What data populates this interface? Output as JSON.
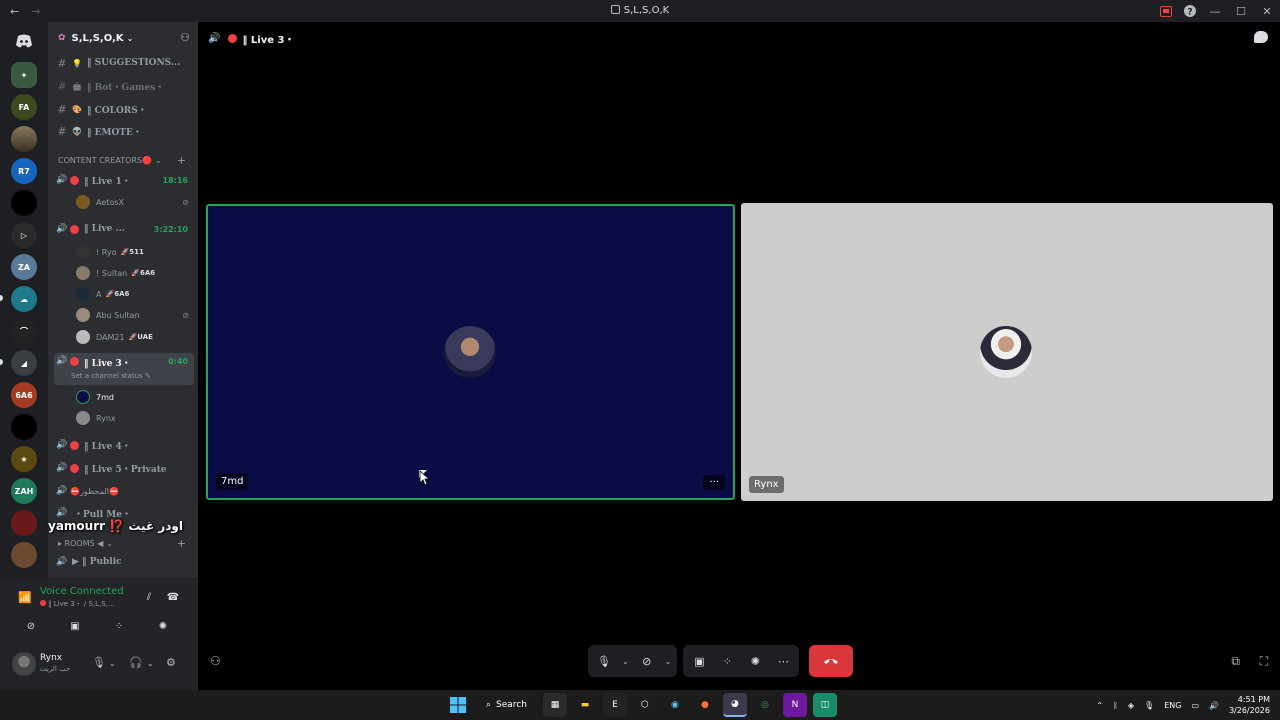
{
  "window": {
    "title": "S,L,S,O,K",
    "back_glyph": "←",
    "forward_glyph": "→"
  },
  "server": {
    "name": "S,L,S,O,K"
  },
  "text_channels": [
    {
      "emoji": "💡",
      "label": "‖ SUGGESTIONS..."
    },
    {
      "emoji": "🤖",
      "label": "‖ Bot・Games・"
    },
    {
      "emoji": "🎨",
      "label": "‖ COLORS・"
    },
    {
      "emoji": "👽",
      "label": "‖ EMOTE・"
    }
  ],
  "category_content": "CONTENT CREATORS🔴",
  "voice": {
    "live1": {
      "label": "‖ Live 1・",
      "time": "18:16"
    },
    "live1_members": [
      {
        "name": "AetosX",
        "tag": ""
      }
    ],
    "live2": {
      "label": "‖ Live ...",
      "time": "3:22:10"
    },
    "live2_members": [
      {
        "name": "! Ryo",
        "tag": "🚀511"
      },
      {
        "name": "! Sultan",
        "tag": "🚀6A6"
      },
      {
        "name": "A",
        "tag": "🚀6A6"
      },
      {
        "name": "Abu Sultan",
        "tag": ""
      },
      {
        "name": "DAM21",
        "tag": "🚀UAE"
      }
    ],
    "live3": {
      "label": "‖ Live 3・",
      "time": "0:40",
      "status": "Set a channel status ✎"
    },
    "live3_members": [
      {
        "name": "7md",
        "tag": ""
      },
      {
        "name": "Rynx",
        "tag": ""
      }
    ],
    "live4": {
      "label": "‖ Live 4・"
    },
    "live5": {
      "label": "‖ Live 5・Private"
    },
    "forbidden": {
      "label": "⛔المحظور⛔"
    },
    "pullme": {
      "label": "・Pull Me・"
    }
  },
  "category_rooms": "▸ ROOMS ◀",
  "public_channel": "▶ ‖ Public",
  "overlay_text": "yamourr ⁉️ اودر غيث",
  "voice_panel": {
    "title": "Voice Connected",
    "subtitle": "‖ Live 3・ / S,L,S,..."
  },
  "user": {
    "name": "Rynx",
    "status": "حب الزيت"
  },
  "call": {
    "header_label": "‖ Live 3・",
    "tiles": [
      {
        "name": "7md",
        "more": "···"
      },
      {
        "name": "Rynx"
      }
    ]
  },
  "taskbar": {
    "search_label": "Search",
    "lang": "ENG",
    "time": "4:51 PM",
    "date": "3/26/2026"
  },
  "colors": {
    "accent_green": "#23a55a",
    "hangup_red": "#da373c",
    "tile1_bg": "#0b0b45",
    "tile2_bg": "#cdcdcc"
  }
}
